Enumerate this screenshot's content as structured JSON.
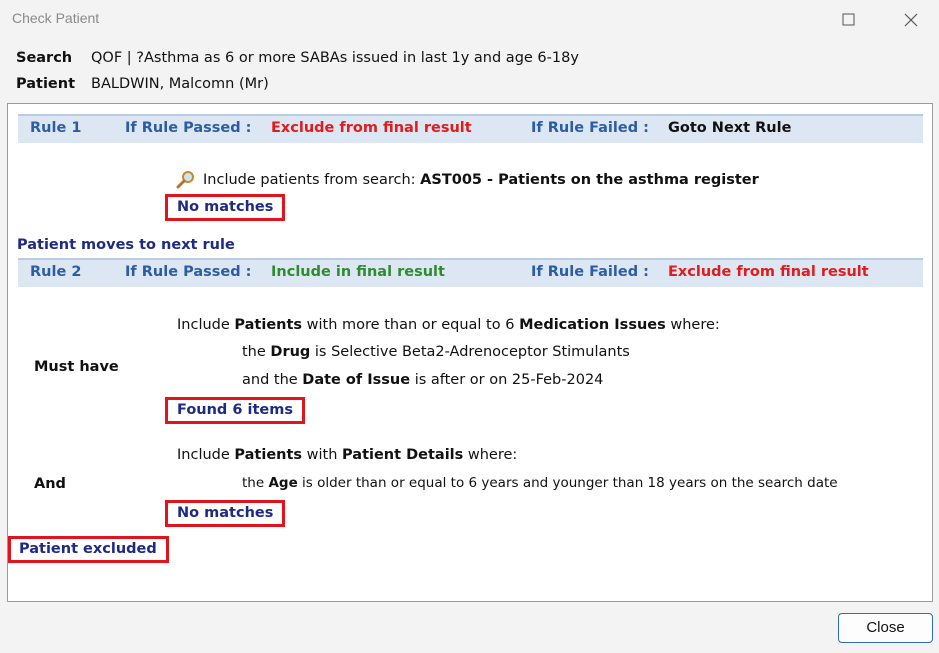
{
  "window": {
    "title": "Check Patient"
  },
  "header": {
    "search_label": "Search",
    "search_value": "QOF | ?Asthma as 6 or more SABAs issued in last 1y and age 6-18y",
    "patient_label": "Patient",
    "patient_value": "BALDWIN, Malcomn (Mr)"
  },
  "rule1": {
    "number": "Rule 1",
    "passed_label": "If Rule Passed :",
    "passed_action": "Exclude from final result",
    "failed_label": "If Rule Failed :",
    "failed_action": "Goto Next Rule",
    "include_prefix": "Include patients from search:",
    "include_search": "AST005 - Patients on the asthma register",
    "result": "No matches"
  },
  "transition": "Patient moves to next rule",
  "rule2": {
    "number": "Rule 2",
    "passed_label": "If Rule Passed :",
    "passed_action": "Include in final result",
    "failed_label": "If Rule Failed :",
    "failed_action": "Exclude from final result",
    "criterion1": {
      "side_label": "Must have",
      "w_include": "Include",
      "w_patients": "Patients",
      "w_with": "with more than or equal to 6",
      "w_entity": "Medication Issues",
      "w_where": "where:",
      "c1_the": "the",
      "c1_field": "Drug",
      "c1_op": "is Selective Beta2-Adrenoceptor Stimulants",
      "c2_and": "and the",
      "c2_field": "Date of Issue",
      "c2_op": "is after or on 25-Feb-2024",
      "result": "Found 6 items"
    },
    "criterion2": {
      "side_label": "And",
      "w_include": "Include",
      "w_patients": "Patients",
      "w_with": "with",
      "w_entity": "Patient Details",
      "w_where": "where:",
      "c1_the": "the",
      "c1_field": "Age",
      "c1_op": "is older than or equal to 6 years and younger than 18 years on the search date",
      "result": "No matches"
    }
  },
  "final_status": "Patient excluded",
  "footer": {
    "close_label": "Close"
  },
  "colors": {
    "label_blue": "#2a5da6",
    "status_navy": "#1e2a86",
    "fail_red": "#e31b1b",
    "pass_green": "#2e8b2e",
    "highlight_box": "#e0141c"
  }
}
